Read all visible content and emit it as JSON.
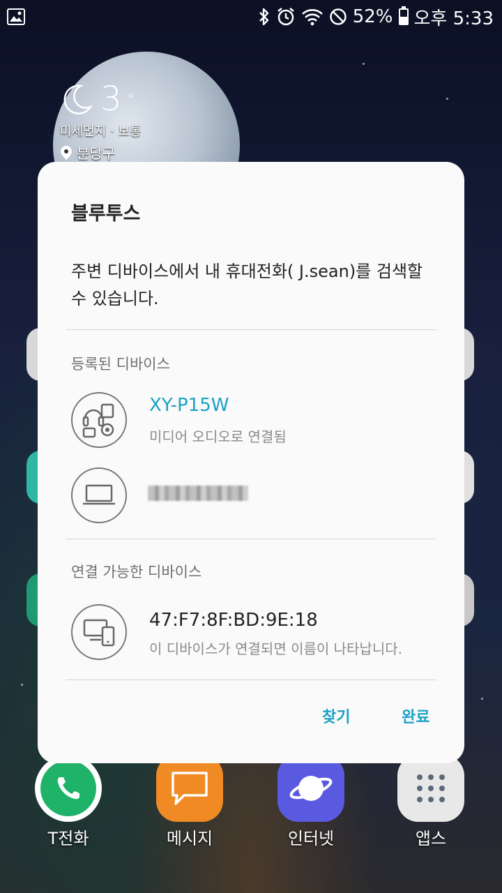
{
  "status_bar": {
    "left_icons": [
      "gallery-notification-icon"
    ],
    "right_icons": [
      "bluetooth-icon",
      "alarm-icon",
      "wifi-icon",
      "do-not-disturb-icon"
    ],
    "battery_percent": "52%",
    "battery_level": 0.52,
    "time": "오후 5:33"
  },
  "weather_widget": {
    "temperature": "3",
    "air_quality": "미세먼지 · 보통",
    "location": "분당구"
  },
  "bluetooth_dialog": {
    "title": "블루투스",
    "message": "주변 디바이스에서 내 휴대전화(  J.sean)를 검색할 수 있습니다.",
    "registered_section": {
      "header": "등록된 디바이스",
      "devices": [
        {
          "name": "XY-P15W",
          "status": "미디어 오디오로 연결됨",
          "icon": "headphones-speaker-icon",
          "connected": true
        },
        {
          "name": "",
          "status": "",
          "icon": "laptop-icon",
          "connected": false,
          "name_obscured": true
        }
      ]
    },
    "available_section": {
      "header": "연결 가능한 디바이스",
      "devices": [
        {
          "name": "47:F7:8F:BD:9E:18",
          "status": "이 디바이스가 연결되면 이름이 나타납니다.",
          "icon": "multi-device-icon"
        }
      ]
    },
    "buttons": {
      "scan": "찾기",
      "done": "완료"
    },
    "accent_color": "#1aa1c6"
  },
  "dock": {
    "items": [
      {
        "label": "T전화",
        "icon": "phone-icon",
        "color": "#1fb36a"
      },
      {
        "label": "메시지",
        "icon": "message-icon",
        "color": "#f08a24"
      },
      {
        "label": "인터넷",
        "icon": "internet-planet-icon",
        "color": "#5a5ae0"
      },
      {
        "label": "앱스",
        "icon": "apps-grid-icon",
        "color": "#e8e8e8"
      }
    ]
  }
}
